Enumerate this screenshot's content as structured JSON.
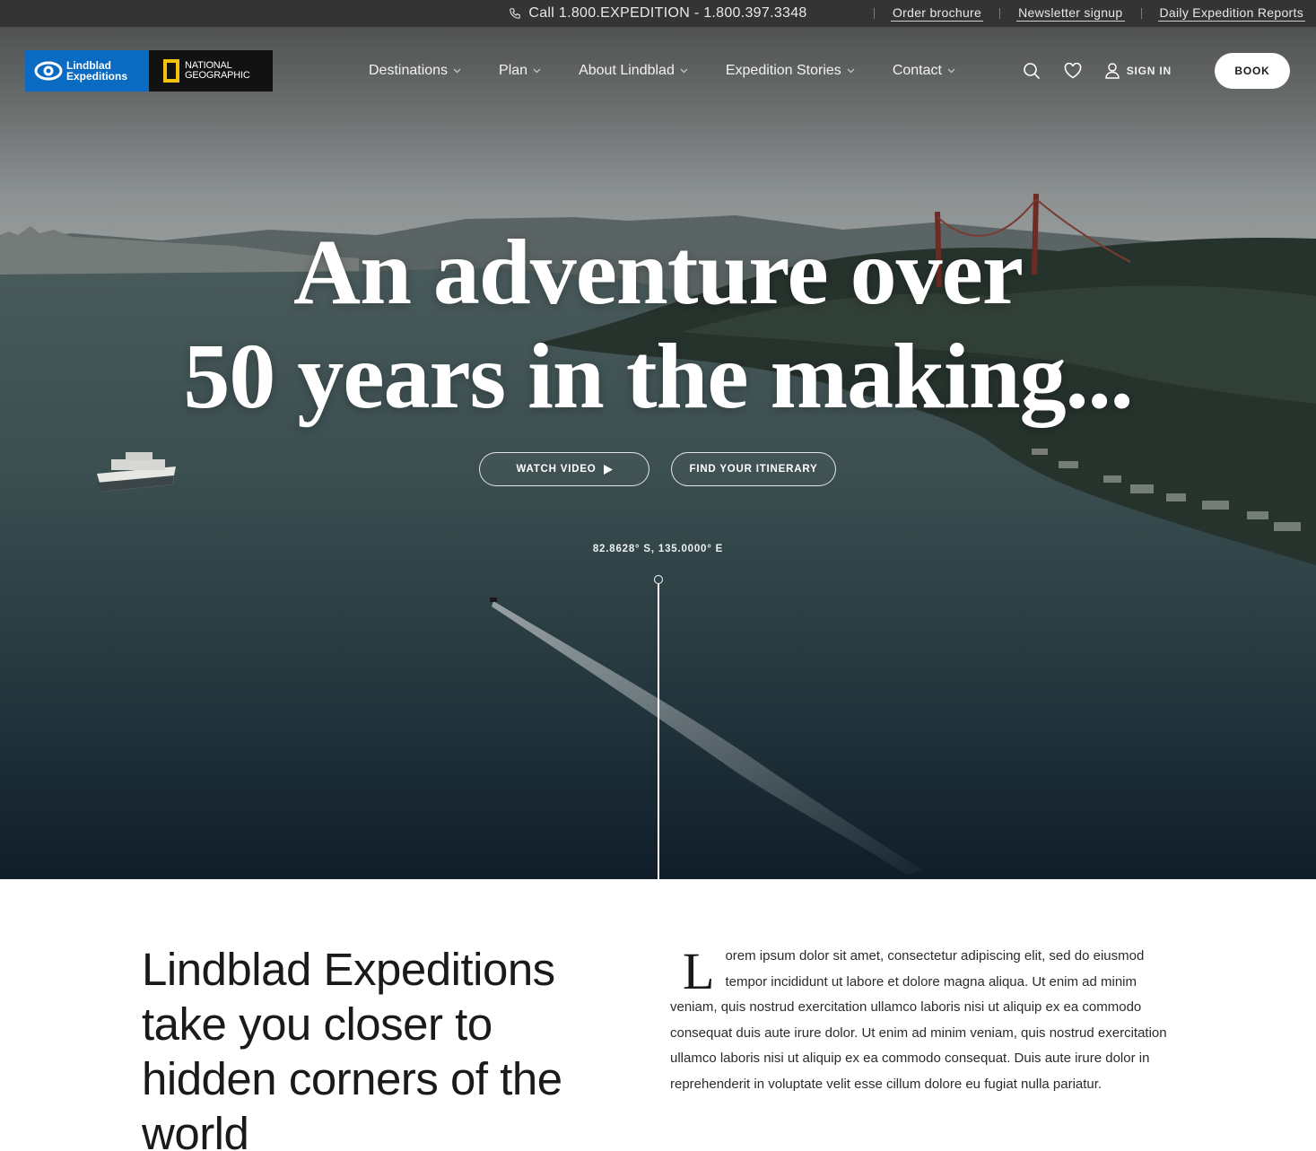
{
  "topbar": {
    "phone_text": "Call 1.800.EXPEDITION - 1.800.397.3348",
    "links": [
      "Order brochure",
      "Newsletter signup",
      "Daily Expedition Reports"
    ]
  },
  "logo": {
    "lindblad_line1": "Lindblad",
    "lindblad_line2": "Expeditions",
    "natgeo_line1": "NATIONAL",
    "natgeo_line2": "GEOGRAPHIC"
  },
  "nav": {
    "items": [
      "Destinations",
      "Plan",
      "About Lindblad",
      "Expedition Stories",
      "Contact"
    ],
    "sign_in": "SIGN IN",
    "book": "BOOK"
  },
  "hero": {
    "headline_line1": "An adventure over",
    "headline_line2": "50 years in the making...",
    "watch_video": "WATCH VIDEO",
    "find_itinerary": "FIND YOUR ITINERARY",
    "coordinates": "82.8628° S, 135.0000° E"
  },
  "intro": {
    "heading": "Lindblad Expeditions take you closer to hidden corners of the world",
    "dropcap": "L",
    "body": "orem ipsum dolor sit amet, consectetur adipiscing elit, sed do eiusmod tempor incididunt ut labore et dolore magna aliqua. Ut enim ad minim veniam, quis nostrud exercitation ullamco laboris nisi ut aliquip ex ea commodo consequat duis aute irure dolor. Ut enim ad minim veniam, quis nostrud exercitation ullamco laboris nisi ut aliquip ex ea commodo consequat. Duis aute irure dolor in reprehenderit in voluptate velit esse cillum dolore eu fugiat nulla pariatur."
  },
  "colors": {
    "topbar_bg": "#343434",
    "lindblad_blue": "#0a6bc2",
    "natgeo_yellow": "#f4c20d",
    "water_dark": "#1c2f37"
  },
  "icons": [
    "phone-icon",
    "chevron-down-icon",
    "search-icon",
    "heart-icon",
    "user-icon",
    "play-icon",
    "eye-logo-icon"
  ]
}
